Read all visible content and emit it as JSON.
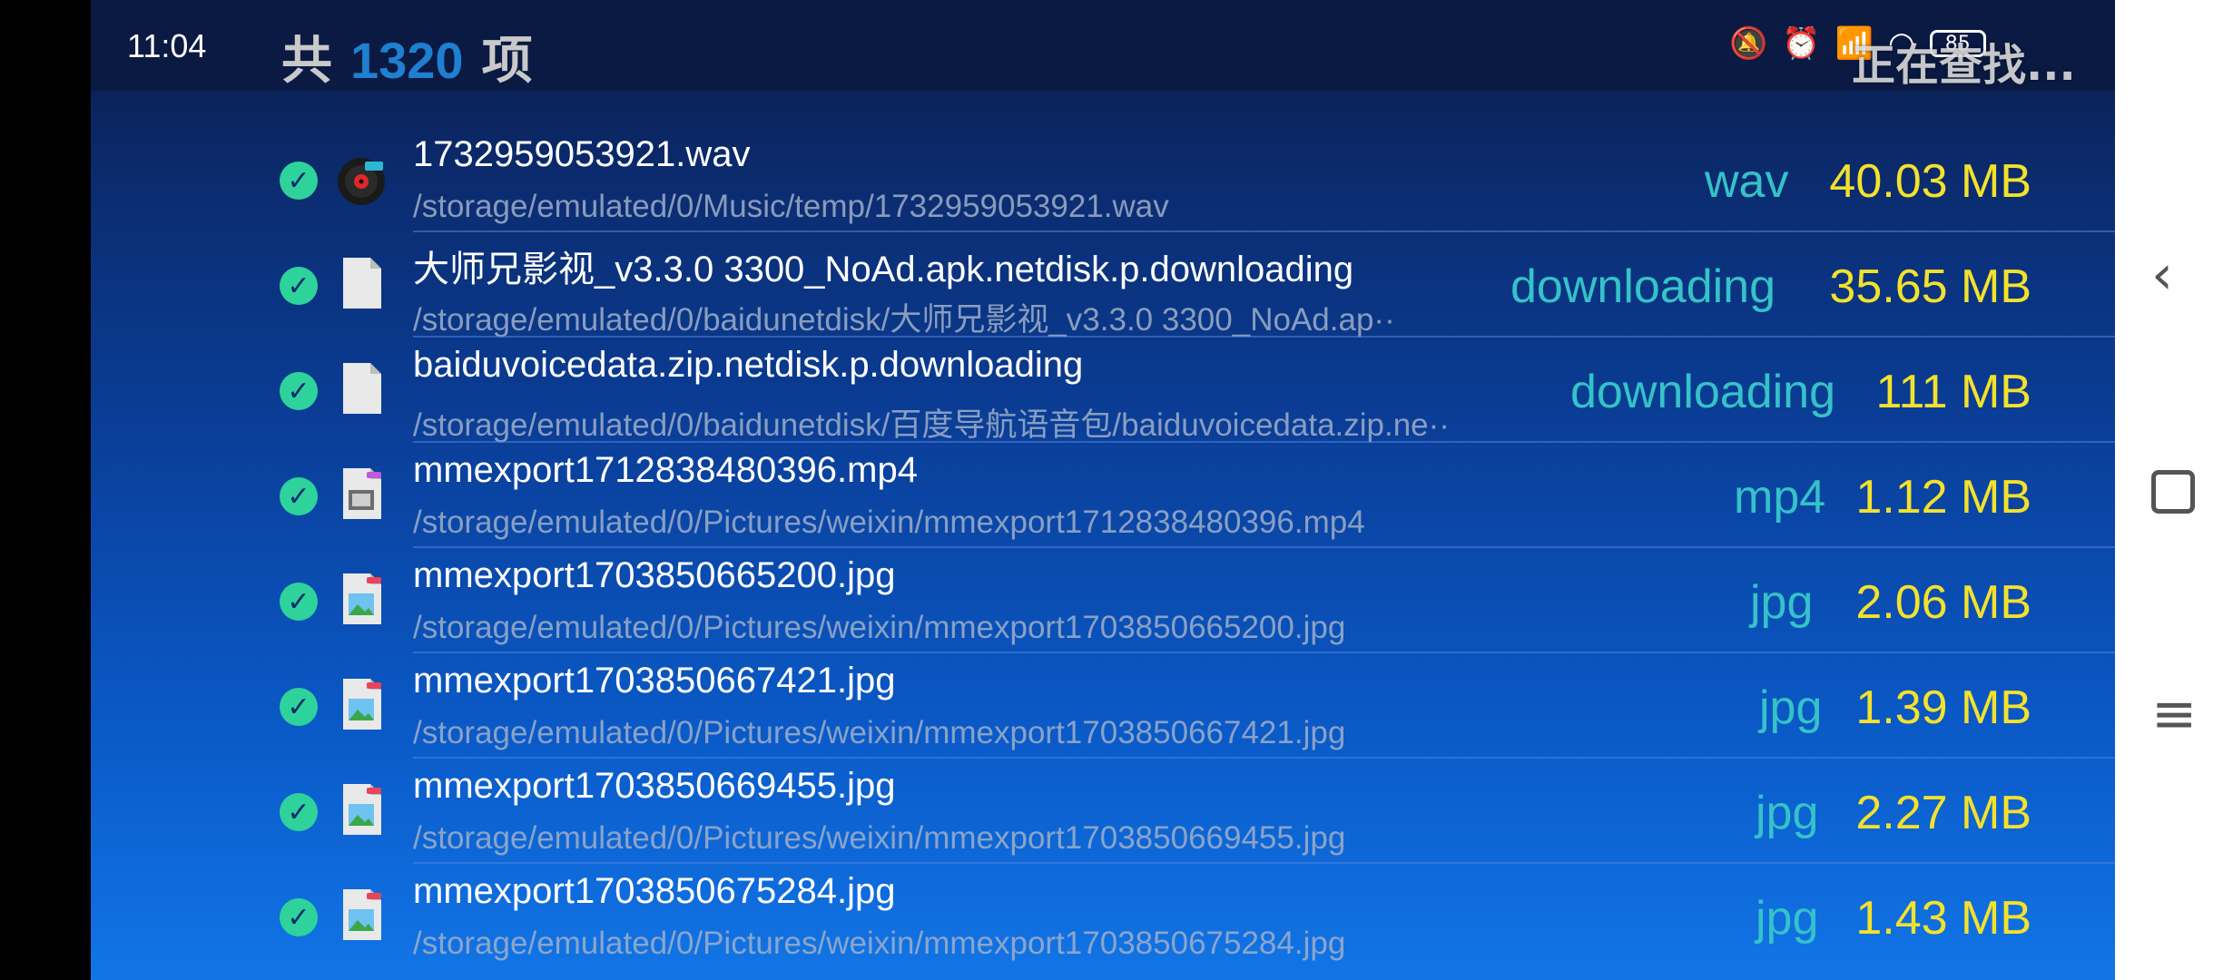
{
  "status": {
    "time": "11:04",
    "battery": "85",
    "overlay_text": "正在查找..."
  },
  "header": {
    "prefix": "共",
    "count": "1320",
    "suffix": "项"
  },
  "files": [
    {
      "name": "1732959053921.wav",
      "path": "/storage/emulated/0/Music/temp/1732959053921.wav",
      "type": "wav",
      "size": "40.03 MB",
      "icon": "audio-disc-icon"
    },
    {
      "name": "大师兄影视_v3.3.0 3300_NoAd.apk.netdisk.p.downloading",
      "path": "/storage/emulated/0/baidunetdisk/大师兄影视_v3.3.0 3300_NoAd.ap··",
      "type": "downloading",
      "size": "35.65 MB",
      "icon": "generic-file-icon"
    },
    {
      "name": "baiduvoicedata.zip.netdisk.p.downloading",
      "path": "/storage/emulated/0/baidunetdisk/百度导航语音包/baiduvoicedata.zip.ne··",
      "type": "downloading",
      "size": "111 MB",
      "icon": "generic-file-icon"
    },
    {
      "name": "mmexport1712838480396.mp4",
      "path": "/storage/emulated/0/Pictures/weixin/mmexport1712838480396.mp4",
      "type": "mp4",
      "size": "1.12 MB",
      "icon": "video-file-icon"
    },
    {
      "name": "mmexport1703850665200.jpg",
      "path": "/storage/emulated/0/Pictures/weixin/mmexport1703850665200.jpg",
      "type": "jpg",
      "size": "2.06 MB",
      "icon": "image-file-icon"
    },
    {
      "name": "mmexport1703850667421.jpg",
      "path": "/storage/emulated/0/Pictures/weixin/mmexport1703850667421.jpg",
      "type": "jpg",
      "size": "1.39 MB",
      "icon": "image-file-icon"
    },
    {
      "name": "mmexport1703850669455.jpg",
      "path": "/storage/emulated/0/Pictures/weixin/mmexport1703850669455.jpg",
      "type": "jpg",
      "size": "2.27 MB",
      "icon": "image-file-icon"
    },
    {
      "name": "mmexport1703850675284.jpg",
      "path": "/storage/emulated/0/Pictures/weixin/mmexport1703850675284.jpg",
      "type": "jpg",
      "size": "1.43 MB",
      "icon": "image-file-icon"
    }
  ],
  "colors": {
    "check": "#2ed39b",
    "type": "#35c2c8",
    "size": "#f3e12c",
    "count": "#1f7fd0"
  }
}
